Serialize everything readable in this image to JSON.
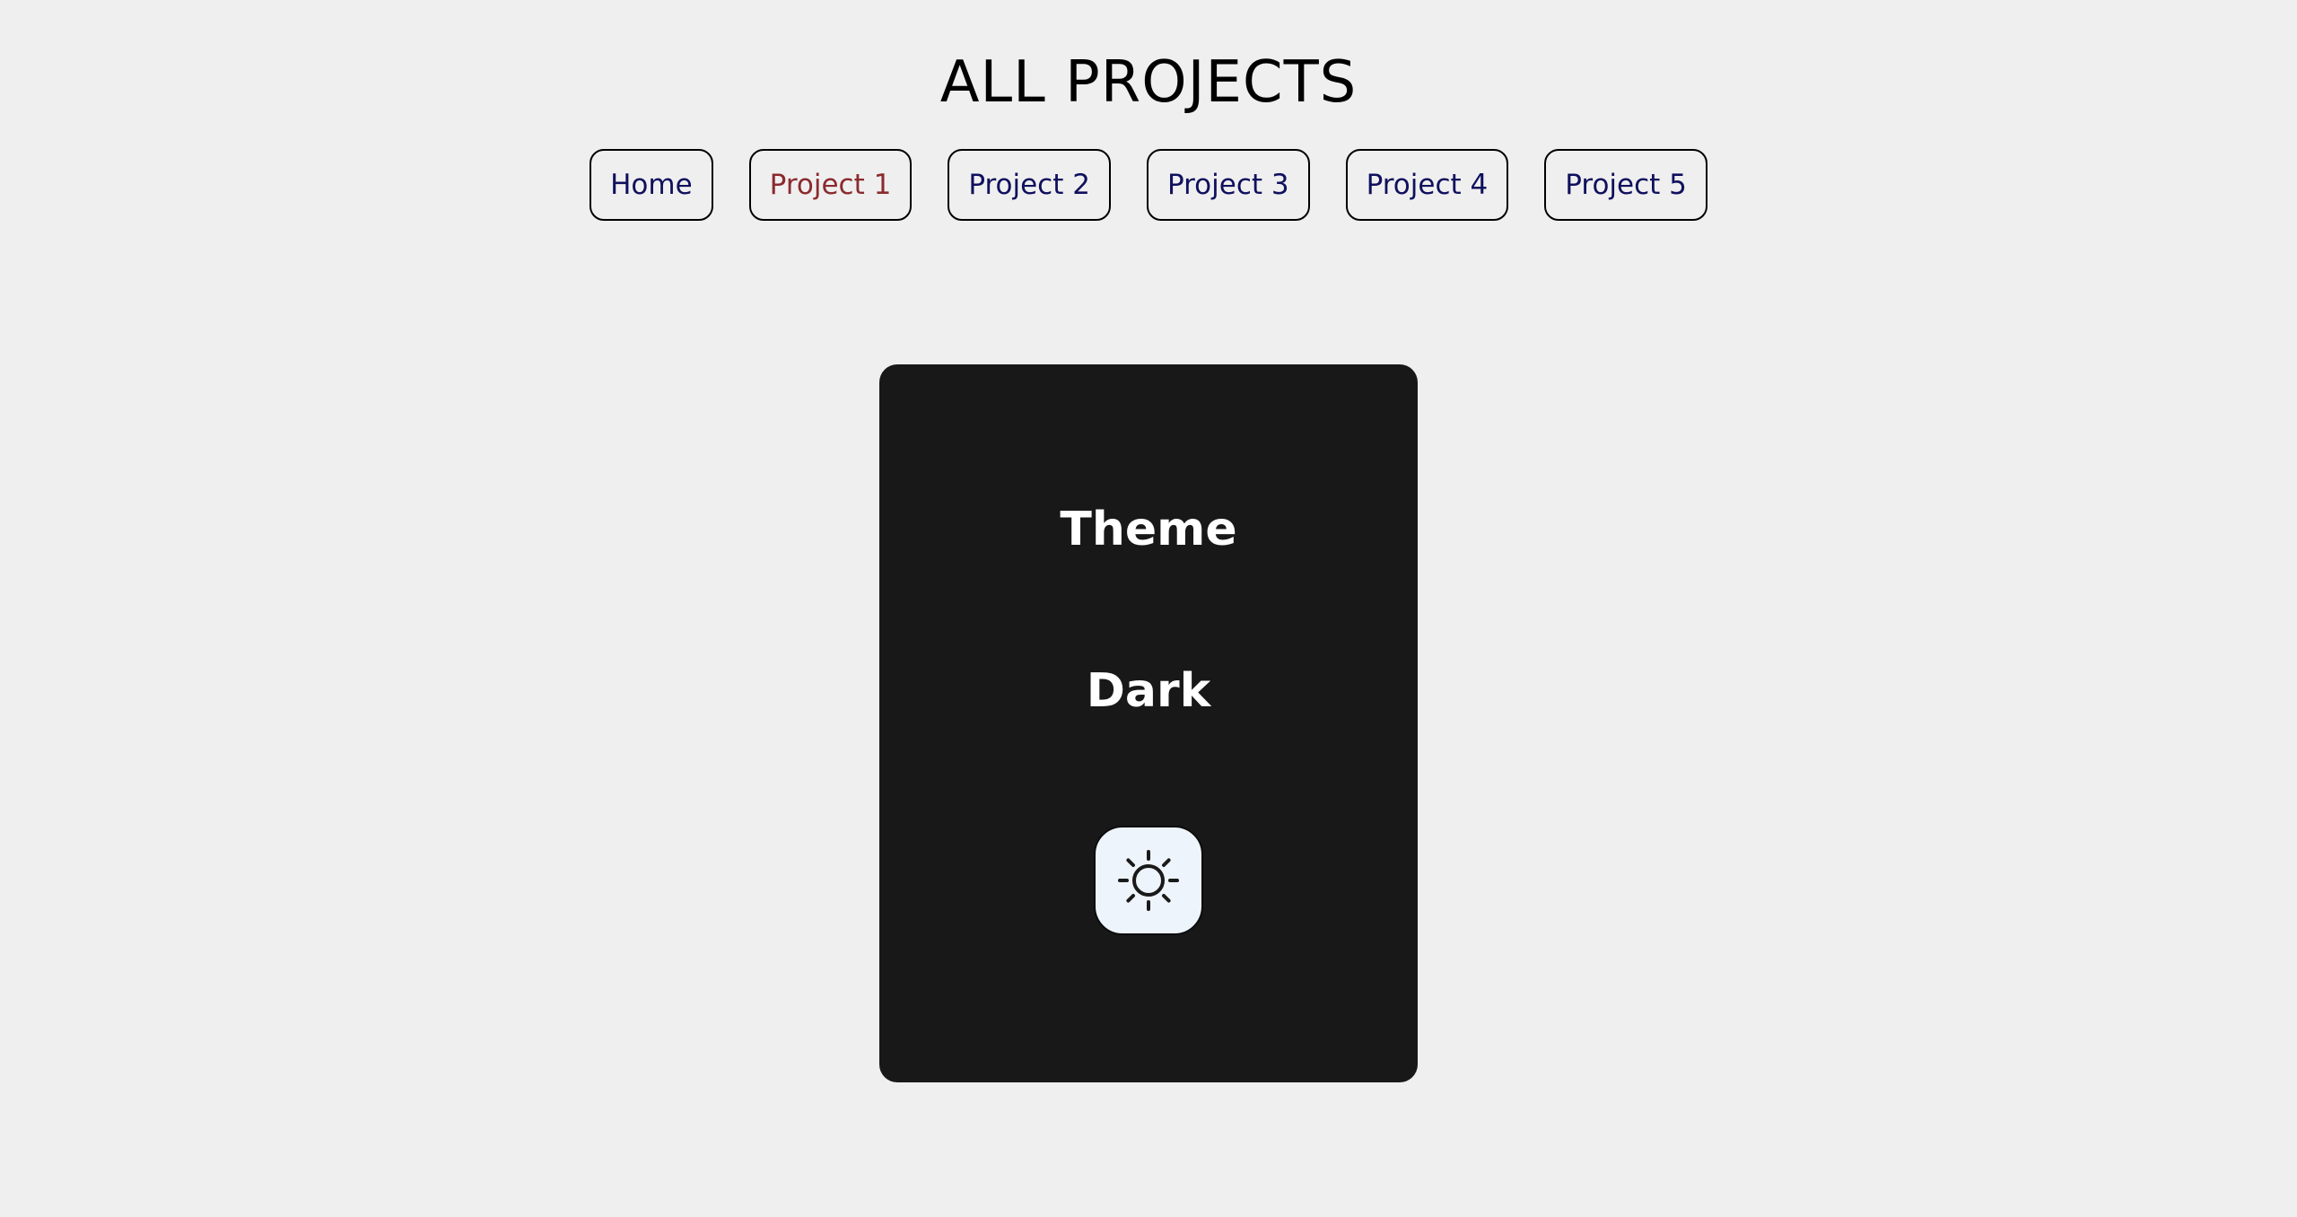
{
  "header": {
    "title": "ALL PROJECTS"
  },
  "nav": {
    "items": [
      {
        "label": "Home",
        "active": false
      },
      {
        "label": "Project 1",
        "active": true
      },
      {
        "label": "Project 2",
        "active": false
      },
      {
        "label": "Project 3",
        "active": false
      },
      {
        "label": "Project 4",
        "active": false
      },
      {
        "label": "Project 5",
        "active": false
      }
    ]
  },
  "card": {
    "heading": "Theme",
    "mode_label": "Dark",
    "toggle_icon": "sun-icon"
  },
  "colors": {
    "background": "#efefef",
    "nav_text": "#10105e",
    "nav_active_text": "#8b2a2e",
    "card_background": "#181818",
    "card_text": "#ffffff",
    "toggle_background": "#eef4fb"
  }
}
